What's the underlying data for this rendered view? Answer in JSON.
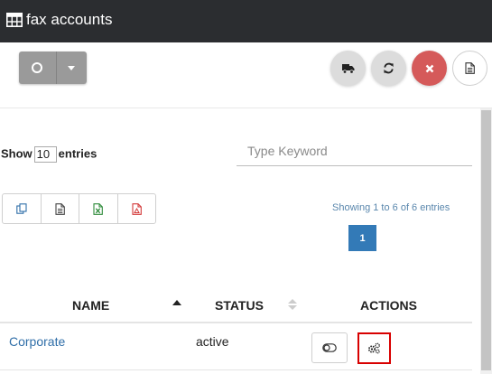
{
  "header": {
    "title": "fax accounts",
    "icon": "table-icon"
  },
  "toolbar": {
    "split_button_icon": "circle-icon",
    "actions": [
      {
        "name": "truck-icon"
      },
      {
        "name": "refresh-icon"
      },
      {
        "name": "close-icon",
        "color": "#d55a5a"
      },
      {
        "name": "document-icon"
      }
    ]
  },
  "table_controls": {
    "show_label": "Show",
    "length_value": "10",
    "entries_label": "entries",
    "search_placeholder": "Type Keyword",
    "export_buttons": [
      {
        "name": "copy-icon"
      },
      {
        "name": "csv-icon"
      },
      {
        "name": "excel-icon"
      },
      {
        "name": "pdf-icon"
      }
    ],
    "info": "Showing 1 to 6 of 6 entries",
    "current_page": "1"
  },
  "table": {
    "headers": {
      "name": "NAME",
      "status": "STATUS",
      "actions": "ACTIONS"
    },
    "rows": [
      {
        "name": "Corporate",
        "status": "active"
      }
    ]
  },
  "colors": {
    "header_bg": "#2b2d30",
    "accent": "#337ab7",
    "danger": "#d55a5a",
    "highlight_border": "#d80000"
  }
}
